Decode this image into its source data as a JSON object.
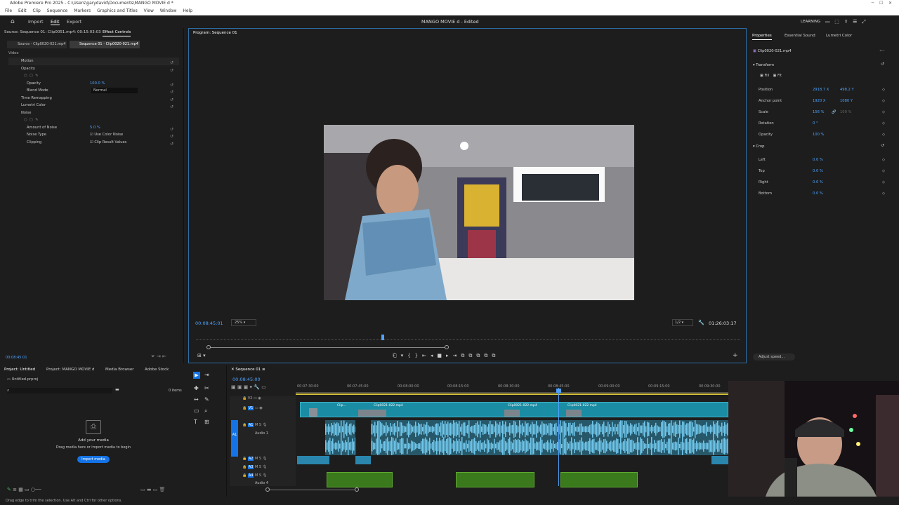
{
  "window": {
    "title": "Adobe Premiere Pro 2025 - C:\\Users\\garydavid\\Documents\\MANGO MOVIE d *"
  },
  "menu": [
    "File",
    "Edit",
    "Clip",
    "Sequence",
    "Markers",
    "Graphics and Titles",
    "View",
    "Window",
    "Help"
  ],
  "workspace": {
    "tabs": [
      "Import",
      "Edit",
      "Export"
    ],
    "project_title": "MANGO MOVIE d - Edited",
    "learning": "LEARNING"
  },
  "effect_controls": {
    "header_left": "Source: Sequence 01: Clip0051.mp4: 00:15:03:03",
    "header_tab": "Effect Controls",
    "source_tab": "Source - Clip0020-021.mp4",
    "seq_tab": "Sequence 01 - Clip0020-021.mp4",
    "section": "Video",
    "rows": [
      {
        "label": "Motion",
        "value": ""
      },
      {
        "label": "Opacity",
        "value": ""
      },
      {
        "label": "Opacity",
        "value": "100.0 %"
      },
      {
        "label": "Blend Mode",
        "value": "Normal"
      },
      {
        "label": "Time Remapping",
        "value": ""
      },
      {
        "label": "Lumetri Color",
        "value": ""
      },
      {
        "label": "Noise",
        "value": ""
      },
      {
        "label": "Amount of Noise",
        "value": "5.0 %"
      },
      {
        "label": "Noise Type",
        "value": "Use Color Noise"
      },
      {
        "label": "Clipping",
        "value": "Clip Result Values"
      }
    ],
    "timecode": "00:08:45:01"
  },
  "program": {
    "title": "Program: Sequence 01",
    "timecode": "00:08:45:01",
    "zoom": "25%",
    "resolution": "1/2",
    "duration": "01:26:03:17"
  },
  "properties": {
    "tabs": [
      "Properties",
      "Essential Sound",
      "Lumetri Color"
    ],
    "clip": "Clip0020-021.mp4",
    "transform": "Transform",
    "fill": "Fill",
    "fit": "Fit",
    "rows": [
      {
        "label": "Position",
        "v1": "2918.7 X",
        "v2": "498.2 Y"
      },
      {
        "label": "Anchor point",
        "v1": "1920 X",
        "v2": "1080 Y"
      },
      {
        "label": "Scale",
        "v1": "156 %",
        "v2": "100 %"
      },
      {
        "label": "Rotation",
        "v1": "0 °",
        "v2": ""
      },
      {
        "label": "Opacity",
        "v1": "100 %",
        "v2": ""
      }
    ],
    "crop": "Crop",
    "crop_rows": [
      {
        "label": "Left",
        "v1": "0.0 %"
      },
      {
        "label": "Top",
        "v1": "0.0 %"
      },
      {
        "label": "Right",
        "v1": "0.0 %"
      },
      {
        "label": "Bottom",
        "v1": "0.0 %"
      }
    ],
    "adjust_speed": "Adjust speed..."
  },
  "project": {
    "tabs": [
      "Project: Untitled",
      "Project: MANGO MOVIE d",
      "Media Browser",
      "Adobe Stock"
    ],
    "file": "Untitled.prproj",
    "items": "0 items",
    "add_media": "Add your media",
    "drag_hint": "Drag media here or import media to begin",
    "import_btn": "Import media"
  },
  "timeline": {
    "title": "Sequence 01",
    "timecode": "00:08:45:00",
    "ruler": [
      "00:07:30:00",
      "00:07:45:00",
      "00:08:00:00",
      "00:08:15:00",
      "00:08:30:00",
      "00:08:45:00",
      "00:09:00:00",
      "00:09:15:00",
      "00:09:30:00"
    ],
    "tracks": [
      "V2",
      "V1",
      "A1",
      "A2",
      "A3",
      "A4"
    ],
    "audio1": "Audio 1",
    "audio4": "Audio 4",
    "clips": [
      "Clip0021-022.mp4",
      "Clip0021-022.mp4",
      "Clip0021-022.mp4",
      "Clip..."
    ]
  },
  "status": "Drag edge to trim the selection. Use Alt and Ctrl for other options.",
  "colors": {
    "accent": "#1473e6",
    "timecode": "#4fa3ff",
    "playhead": "#4fa3ff",
    "video_clip": "#1a8ca4",
    "audio_green": "#3a7a1c"
  }
}
